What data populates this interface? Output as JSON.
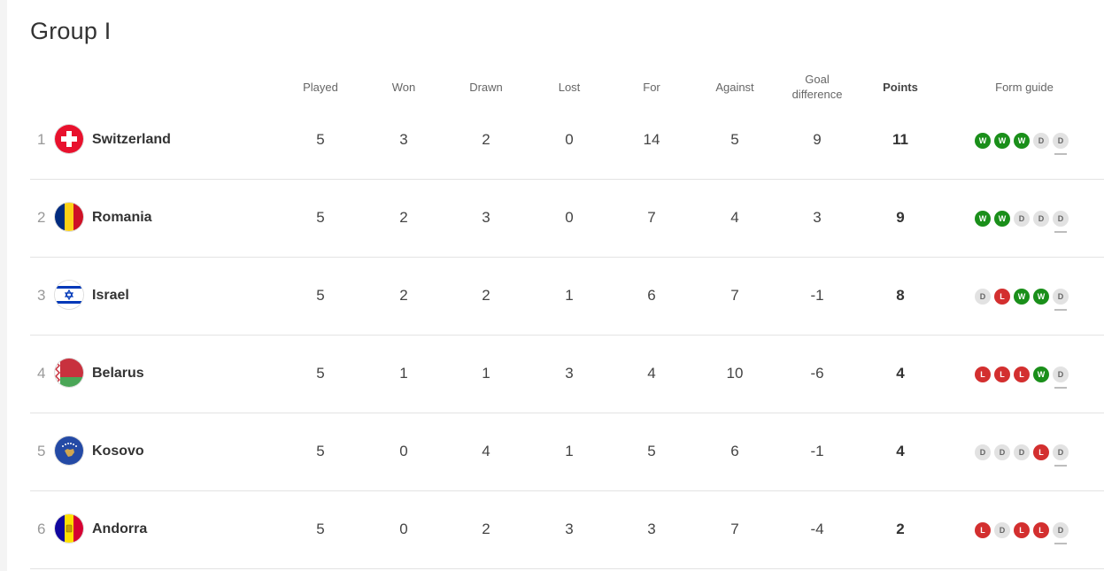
{
  "group_title": "Group I",
  "headers": {
    "played": "Played",
    "won": "Won",
    "drawn": "Drawn",
    "lost": "Lost",
    "for": "For",
    "against": "Against",
    "goal_difference_1": "Goal",
    "goal_difference_2": "difference",
    "points": "Points",
    "form_guide": "Form guide"
  },
  "rows": [
    {
      "pos": "1",
      "team": "Switzerland",
      "played": "5",
      "won": "3",
      "drawn": "2",
      "lost": "0",
      "for": "14",
      "against": "5",
      "gd": "9",
      "points": "11",
      "form": [
        "W",
        "W",
        "W",
        "D",
        "D"
      ],
      "flag": "switzerland-flag-icon"
    },
    {
      "pos": "2",
      "team": "Romania",
      "played": "5",
      "won": "2",
      "drawn": "3",
      "lost": "0",
      "for": "7",
      "against": "4",
      "gd": "3",
      "points": "9",
      "form": [
        "W",
        "W",
        "D",
        "D",
        "D"
      ],
      "flag": "romania-flag-icon"
    },
    {
      "pos": "3",
      "team": "Israel",
      "played": "5",
      "won": "2",
      "drawn": "2",
      "lost": "1",
      "for": "6",
      "against": "7",
      "gd": "-1",
      "points": "8",
      "form": [
        "D",
        "L",
        "W",
        "W",
        "D"
      ],
      "flag": "israel-flag-icon"
    },
    {
      "pos": "4",
      "team": "Belarus",
      "played": "5",
      "won": "1",
      "drawn": "1",
      "lost": "3",
      "for": "4",
      "against": "10",
      "gd": "-6",
      "points": "4",
      "form": [
        "L",
        "L",
        "L",
        "W",
        "D"
      ],
      "flag": "belarus-flag-icon"
    },
    {
      "pos": "5",
      "team": "Kosovo",
      "played": "5",
      "won": "0",
      "drawn": "4",
      "lost": "1",
      "for": "5",
      "against": "6",
      "gd": "-1",
      "points": "4",
      "form": [
        "D",
        "D",
        "D",
        "L",
        "D"
      ],
      "flag": "kosovo-flag-icon"
    },
    {
      "pos": "6",
      "team": "Andorra",
      "played": "5",
      "won": "0",
      "drawn": "2",
      "lost": "3",
      "for": "3",
      "against": "7",
      "gd": "-4",
      "points": "2",
      "form": [
        "L",
        "D",
        "L",
        "L",
        "D"
      ],
      "flag": "andorra-flag-icon"
    }
  ],
  "colors": {
    "win": "#1a8f1a",
    "loss": "#d32f2f",
    "draw": "#e2e2e2"
  }
}
